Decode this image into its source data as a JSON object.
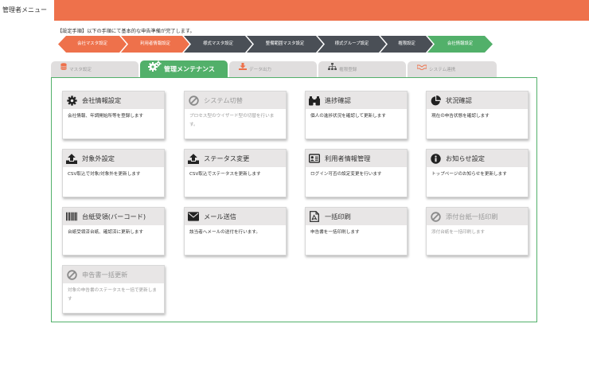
{
  "header": {
    "title": "管理者メニュー",
    "accent_color": "#ee714b"
  },
  "notice": "【設定手順】以下の手順にて基本的な申告準備が完了します。",
  "steps": [
    {
      "label": "会社マスタ設定",
      "color": "orange"
    },
    {
      "label": "利用者情報設定",
      "color": "orange"
    },
    {
      "label": "様式マスタ設定",
      "color": "dark"
    },
    {
      "label": "整備範囲マスタ設定",
      "color": "dark"
    },
    {
      "label": "様式グループ設定",
      "color": "dark"
    },
    {
      "label": "権限設定",
      "color": "dark"
    },
    {
      "label": "会社情報設定",
      "color": "green"
    }
  ],
  "tabs": [
    {
      "label": "マスタ設定",
      "icon": "database-icon",
      "active": false
    },
    {
      "label": "管理メンテナンス",
      "icon": "gears-icon",
      "active": true
    },
    {
      "label": "データ出力",
      "icon": "download-icon",
      "active": false
    },
    {
      "label": "権限登録",
      "icon": "org-chart-icon",
      "active": false
    },
    {
      "label": "システム連携",
      "icon": "handshake-icon",
      "active": false
    }
  ],
  "cards": [
    {
      "title": "会社情報設定",
      "desc": "会社情報、年調開始所等を登録します",
      "icon": "gear-icon",
      "disabled": false
    },
    {
      "title": "システム切替",
      "desc": "プロセス型のウイザード型の切替を行います。",
      "icon": "ban-icon",
      "disabled": true
    },
    {
      "title": "進捗確認",
      "desc": "個人の進捗状況を確認して更新します",
      "icon": "binoculars-icon",
      "disabled": false
    },
    {
      "title": "状況確認",
      "desc": "現在の申告状態を確認します",
      "icon": "pie-chart-icon",
      "disabled": false
    },
    {
      "title": "対象外設定",
      "desc": "CSV取込で対象/対象外を更新します",
      "icon": "upload-icon",
      "disabled": false
    },
    {
      "title": "ステータス変更",
      "desc": "CSV取込でステータスを更新します",
      "icon": "upload-icon",
      "disabled": false
    },
    {
      "title": "利用者情報管理",
      "desc": "ログイン可否の設定変更を行います",
      "icon": "id-card-icon",
      "disabled": false
    },
    {
      "title": "お知らせ設定",
      "desc": "トップページのお知らせを更新します",
      "icon": "info-icon",
      "disabled": false
    },
    {
      "title": "台紙受領(バーコード)",
      "desc": "台紙受領済台紙、確認済に更新します",
      "icon": "barcode-icon",
      "disabled": false
    },
    {
      "title": "メール送信",
      "desc": "該当者へメールの送付を行います。",
      "icon": "envelope-icon",
      "disabled": false
    },
    {
      "title": "一括印刷",
      "desc": "申告書を一括印刷します",
      "icon": "pdf-icon",
      "disabled": false
    },
    {
      "title": "添付台紙一括印刷",
      "desc": "添付台紙を一括印刷します",
      "icon": "ban-icon",
      "disabled": true
    },
    {
      "title": "申告書一括更新",
      "desc": "対象の申告書のステータスを一括で更新します",
      "icon": "ban-icon",
      "disabled": true
    }
  ]
}
